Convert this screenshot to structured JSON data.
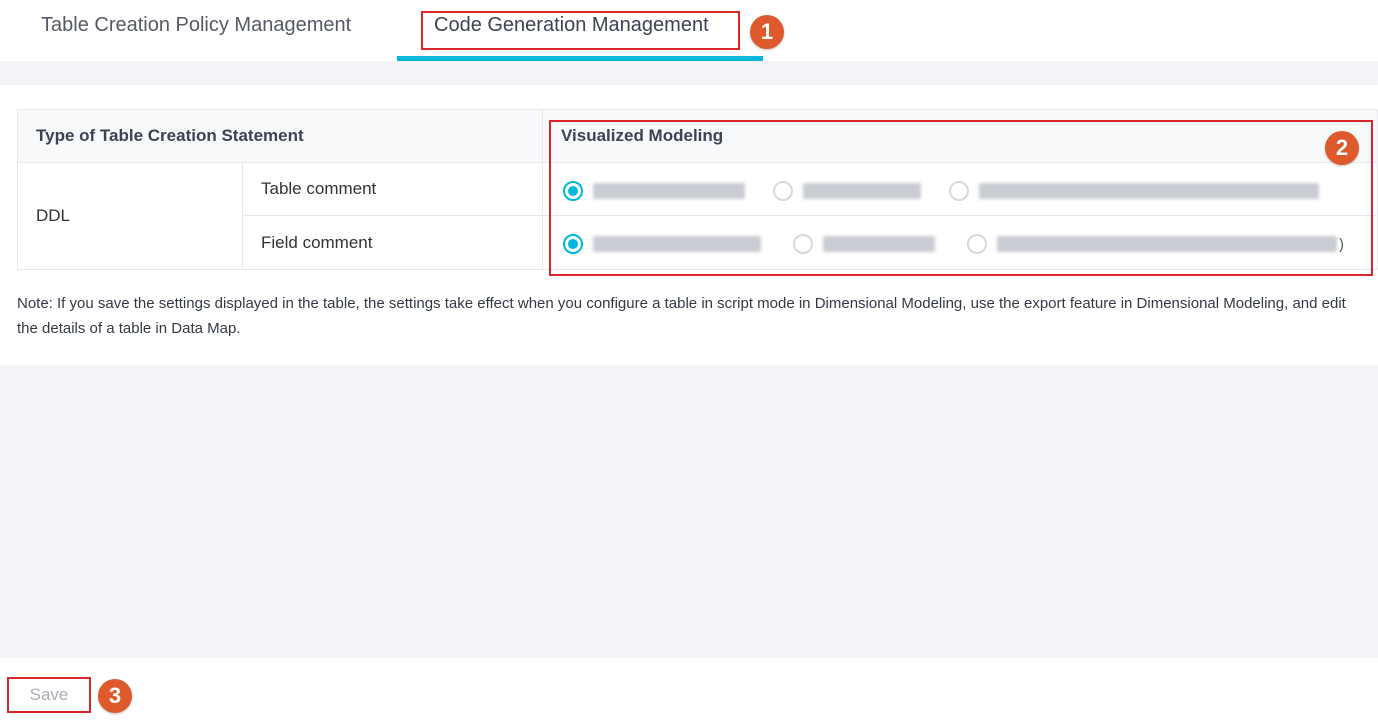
{
  "tabs": [
    {
      "label": "Table Creation Policy Management",
      "active": false
    },
    {
      "label": "Code Generation Management",
      "active": true
    }
  ],
  "callouts": [
    "1",
    "2",
    "3"
  ],
  "table": {
    "header_type": "Type of Table Creation Statement",
    "header_mode": "Visualized Modeling",
    "group": "DDL",
    "rows": [
      {
        "label": "Table comment"
      },
      {
        "label": "Field comment"
      }
    ],
    "trailing_char": ")"
  },
  "note": "Note: If you save the settings displayed in the table, the settings take effect when you configure a table in script mode in Dimensional Modeling, use the export feature in Dimensional Modeling, and edit the details of a table in Data Map.",
  "save_label": "Save",
  "colors": {
    "accent": "#00b8d9",
    "callout": "#de5a2c",
    "highlight_box": "#d9262c"
  }
}
